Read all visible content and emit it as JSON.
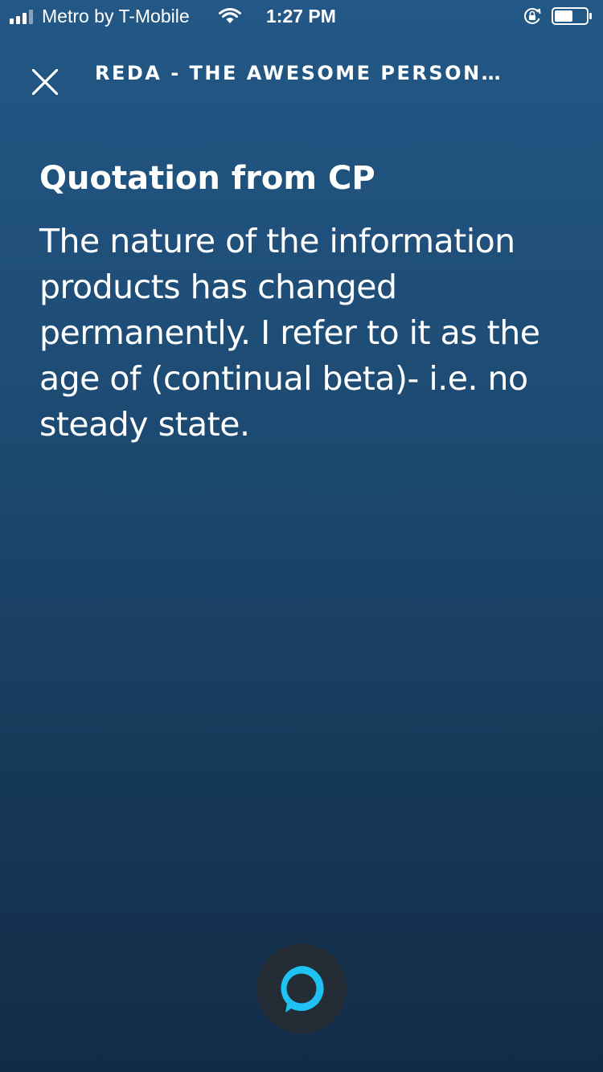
{
  "status_bar": {
    "carrier": "Metro by T-Mobile",
    "time": "1:27 PM",
    "icons": [
      "signal-icon",
      "wifi-icon",
      "rotation-lock-icon",
      "battery-icon"
    ]
  },
  "header": {
    "title": "REDA - THE AWESOME PERSONA...",
    "close_icon": "close-icon"
  },
  "card": {
    "title": "Quotation from CP",
    "body": "The nature of the information products has changed permanently. I refer to it as the age of (continual beta)- i.e. no steady state."
  },
  "alexa": {
    "icon": "alexa-icon"
  },
  "colors": {
    "background_top": "#235886",
    "background_bottom": "#122c47",
    "alexa_ring": "#1ec2f3",
    "alexa_button_bg": "#242c35",
    "text": "#ffffff"
  }
}
